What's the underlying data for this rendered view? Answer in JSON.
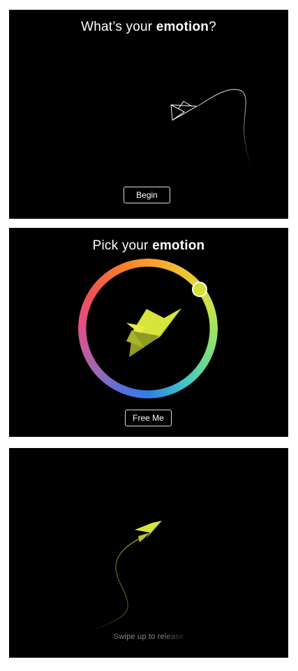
{
  "screens": [
    {
      "title": {
        "prefix": "What’s your ",
        "emphasis": "emotion",
        "suffix": "?"
      },
      "button_label": "Begin"
    },
    {
      "title": {
        "prefix": "Pick your ",
        "emphasis": "emotion",
        "suffix": ""
      },
      "button_label": "Free Me",
      "selected_color": "#d6e03a"
    },
    {
      "hint": "Swipe up to release"
    }
  ],
  "icons": [
    "paper-plane-outline-icon",
    "paper-plane-icon"
  ],
  "colors": {
    "background": "#000000",
    "text": "#ffffff",
    "plane": "#d6e03a"
  }
}
